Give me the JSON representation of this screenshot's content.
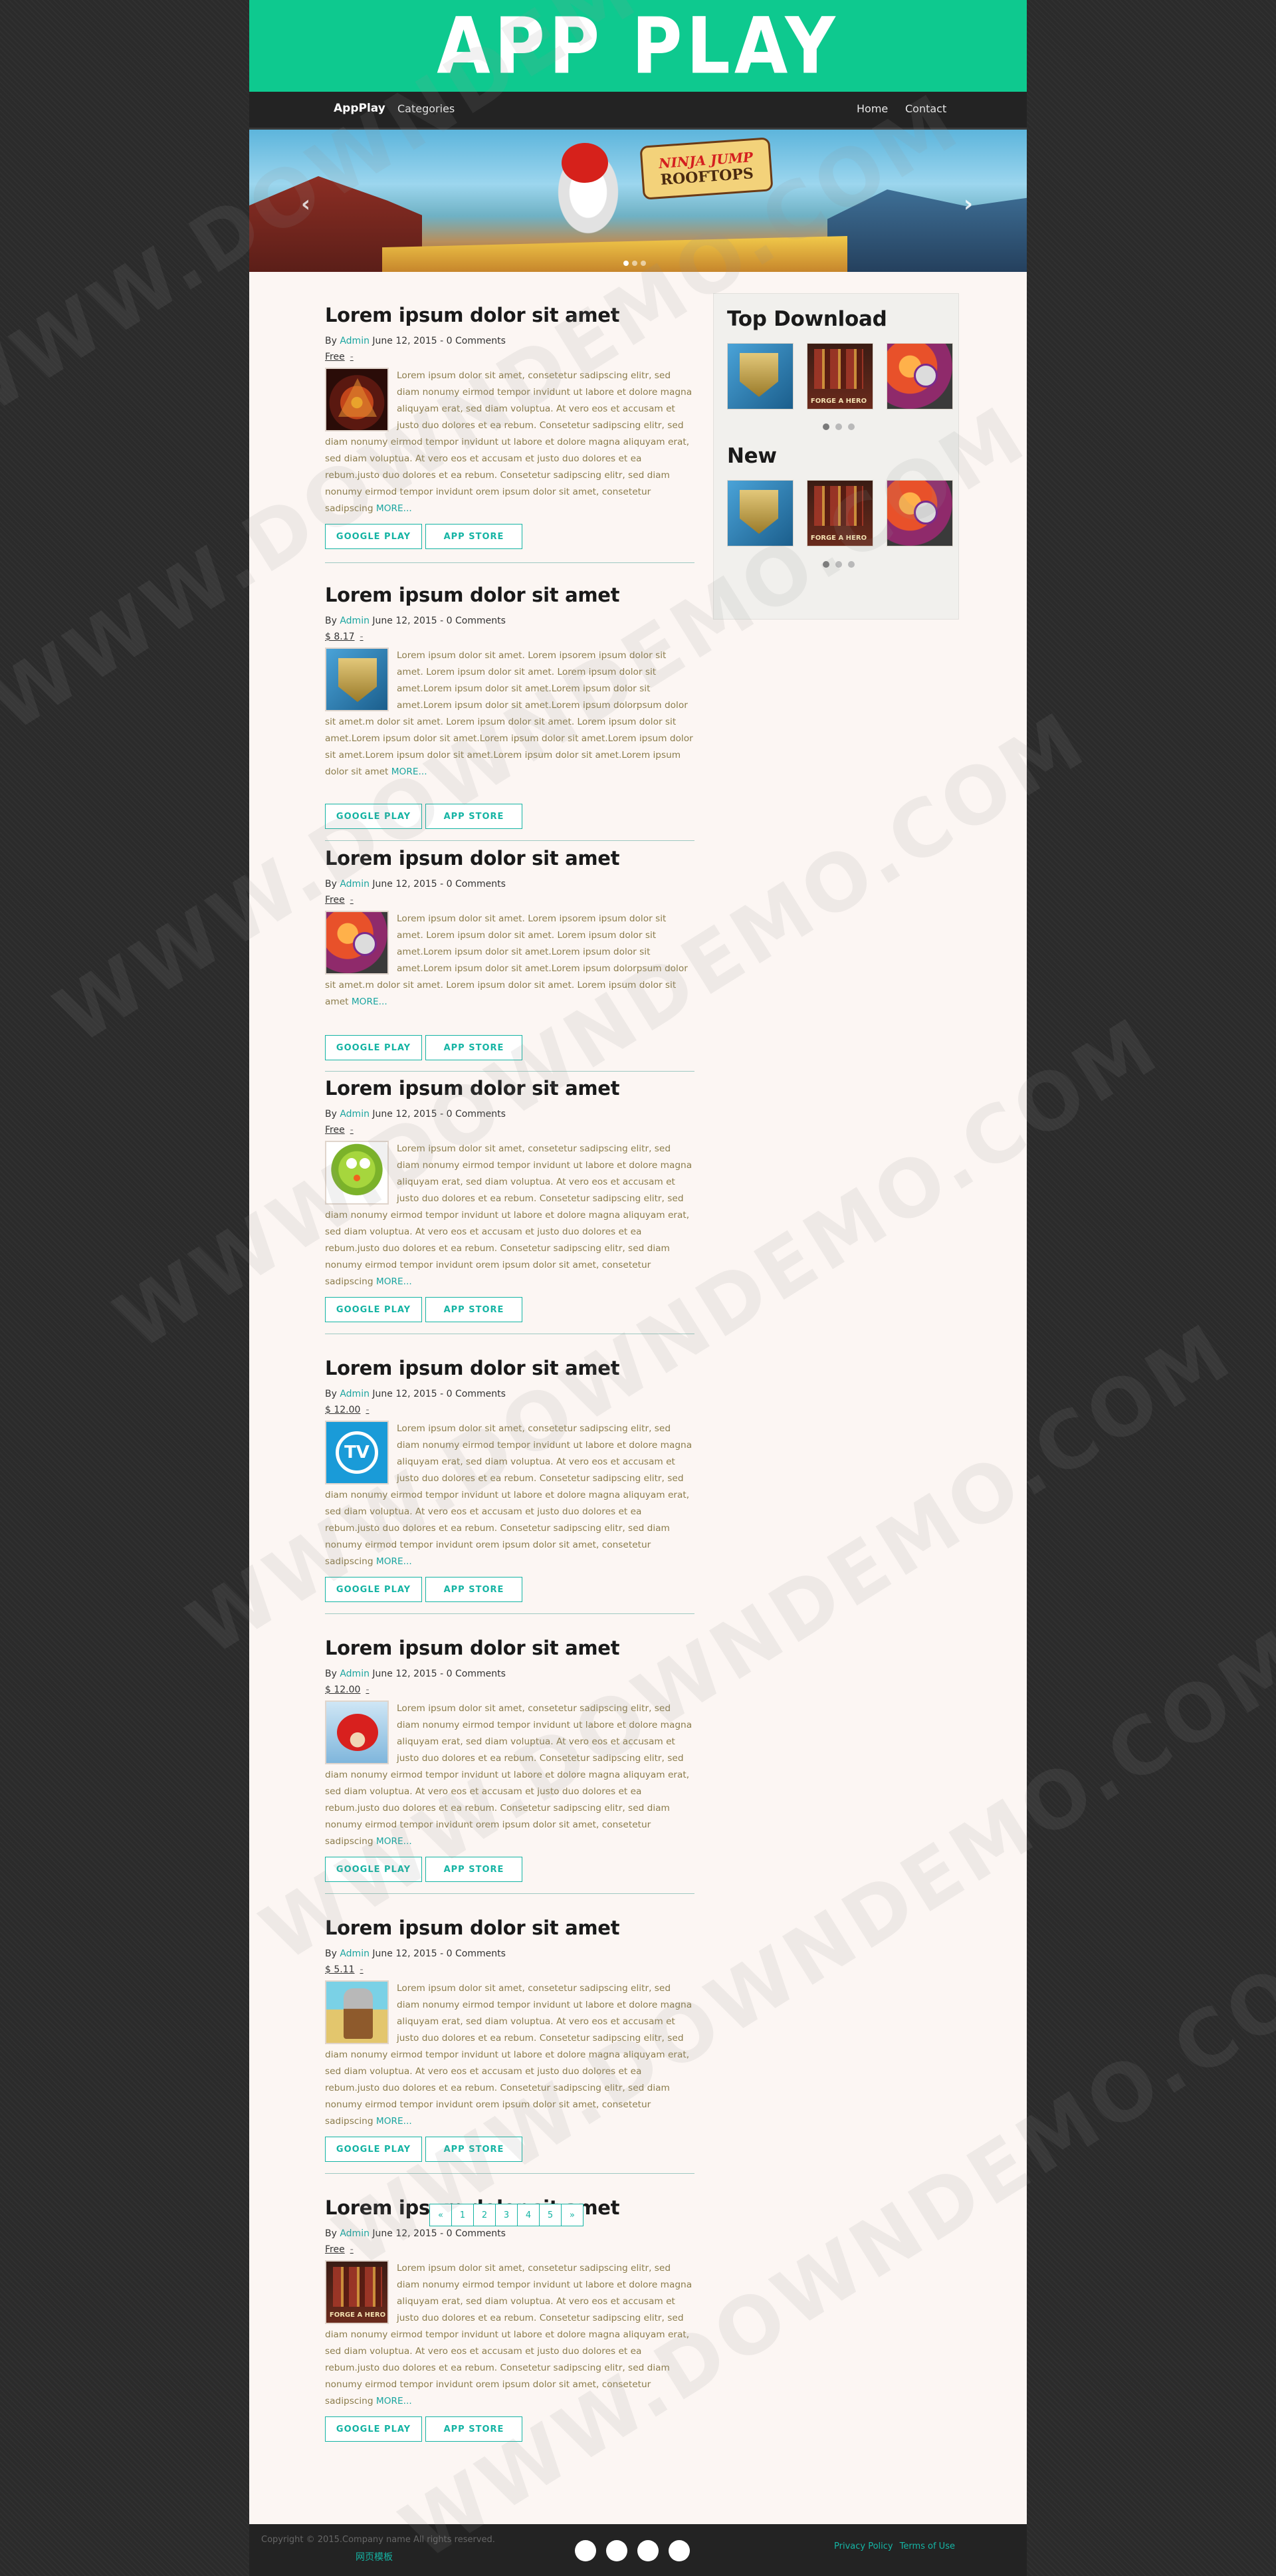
{
  "header": {
    "logo": "APP PLAY"
  },
  "nav": {
    "brand": "AppPlay",
    "categories": "Categories",
    "home": "Home",
    "contact": "Contact"
  },
  "hero": {
    "game_title_1": "NINJA JUMP",
    "game_title_2": "ROOFTOPS",
    "prev_icon": "chevron-left-icon",
    "next_icon": "chevron-right-icon"
  },
  "posts": [
    {
      "title": "Lorem ipsum dolor sit amet",
      "by": "By",
      "author": "Admin",
      "date_comments": "June 12, 2015 - 0 Comments",
      "price": "Free",
      "sep": "-",
      "icon": "eye-icon",
      "body": "Lorem ipsum dolor sit amet, consetetur sadipscing elitr, sed diam nonumy eirmod tempor invidunt ut labore et dolore magna aliquyam erat, sed diam voluptua. At vero eos et accusam et justo duo dolores et ea rebum. Consetetur sadipscing elitr, sed diam nonumy eirmod tempor invidunt ut labore et dolore magna aliquyam erat, sed diam voluptua. At vero eos et accusam et justo duo dolores et ea rebum.justo duo dolores et ea rebum. Consetetur sadipscing elitr, sed diam nonumy eirmod tempor invidunt orem ipsum dolor sit amet, consetetur sadipscing",
      "more": "MORE...",
      "google": "GOOGLE PLAY",
      "apple": "APP STORE"
    },
    {
      "title": "Lorem ipsum dolor sit amet",
      "by": "By",
      "author": "Admin",
      "date_comments": "June 12, 2015 - 0 Comments",
      "price": "$ 8.17",
      "sep": "-",
      "icon": "shield-icon",
      "body": "Lorem ipsum dolor sit amet. Lorem ipsorem ipsum dolor sit amet. Lorem ipsum dolor sit amet. Lorem ipsum dolor sit amet.Lorem ipsum dolor sit amet.Lorem ipsum dolor sit amet.Lorem ipsum dolor sit amet.Lorem ipsum dolorpsum dolor sit amet.m dolor sit amet. Lorem ipsum dolor sit amet. Lorem ipsum dolor sit amet.Lorem ipsum dolor sit amet.Lorem ipsum dolor sit amet.Lorem ipsum dolor sit amet.Lorem ipsum dolor sit amet.Lorem ipsum dolor sit amet.Lorem ipsum dolor sit amet",
      "more": "MORE...",
      "google": "GOOGLE PLAY",
      "apple": "APP STORE"
    },
    {
      "title": "Lorem ipsum dolor sit amet",
      "by": "By",
      "author": "Admin",
      "date_comments": "June 12, 2015 - 0 Comments",
      "price": "Free",
      "sep": "-",
      "icon": "orange-icon",
      "body": "Lorem ipsum dolor sit amet. Lorem ipsorem ipsum dolor sit amet. Lorem ipsum dolor sit amet. Lorem ipsum dolor sit amet.Lorem ipsum dolor sit amet.Lorem ipsum dolor sit amet.Lorem ipsum dolor sit amet.Lorem ipsum dolorpsum dolor sit amet.m dolor sit amet. Lorem ipsum dolor sit amet. Lorem ipsum dolor sit amet",
      "more": "MORE...",
      "google": "GOOGLE PLAY",
      "apple": "APP STORE"
    },
    {
      "title": "Lorem ipsum dolor sit amet",
      "by": "By",
      "author": "Admin",
      "date_comments": "June 12, 2015 - 0 Comments",
      "price": "Free",
      "sep": "-",
      "icon": "bird-icon",
      "body": "Lorem ipsum dolor sit amet, consetetur sadipscing elitr, sed diam nonumy eirmod tempor invidunt ut labore et dolore magna aliquyam erat, sed diam voluptua. At vero eos et accusam et justo duo dolores et ea rebum. Consetetur sadipscing elitr, sed diam nonumy eirmod tempor invidunt ut labore et dolore magna aliquyam erat, sed diam voluptua. At vero eos et accusam et justo duo dolores et ea rebum.justo duo dolores et ea rebum. Consetetur sadipscing elitr, sed diam nonumy eirmod tempor invidunt orem ipsum dolor sit amet, consetetur sadipscing",
      "more": "MORE...",
      "google": "GOOGLE PLAY",
      "apple": "APP STORE"
    },
    {
      "title": "Lorem ipsum dolor sit amet",
      "by": "By",
      "author": "Admin",
      "date_comments": "June 12, 2015 - 0 Comments",
      "price": "$ 12.00",
      "sep": "-",
      "icon": "tv-icon",
      "body": "Lorem ipsum dolor sit amet, consetetur sadipscing elitr, sed diam nonumy eirmod tempor invidunt ut labore et dolore magna aliquyam erat, sed diam voluptua. At vero eos et accusam et justo duo dolores et ea rebum. Consetetur sadipscing elitr, sed diam nonumy eirmod tempor invidunt ut labore et dolore magna aliquyam erat, sed diam voluptua. At vero eos et accusam et justo duo dolores et ea rebum.justo duo dolores et ea rebum. Consetetur sadipscing elitr, sed diam nonumy eirmod tempor invidunt orem ipsum dolor sit amet, consetetur sadipscing",
      "more": "MORE...",
      "google": "GOOGLE PLAY",
      "apple": "APP STORE"
    },
    {
      "title": "Lorem ipsum dolor sit amet",
      "by": "By",
      "author": "Admin",
      "date_comments": "June 12, 2015 - 0 Comments",
      "price": "$ 12.00",
      "sep": "-",
      "icon": "angry-bird-icon",
      "body": "Lorem ipsum dolor sit amet, consetetur sadipscing elitr, sed diam nonumy eirmod tempor invidunt ut labore et dolore magna aliquyam erat, sed diam voluptua. At vero eos et accusam et justo duo dolores et ea rebum. Consetetur sadipscing elitr, sed diam nonumy eirmod tempor invidunt ut labore et dolore magna aliquyam erat, sed diam voluptua. At vero eos et accusam et justo duo dolores et ea rebum.justo duo dolores et ea rebum. Consetetur sadipscing elitr, sed diam nonumy eirmod tempor invidunt orem ipsum dolor sit amet, consetetur sadipscing",
      "more": "MORE...",
      "google": "GOOGLE PLAY",
      "apple": "APP STORE"
    },
    {
      "title": "Lorem ipsum dolor sit amet",
      "by": "By",
      "author": "Admin",
      "date_comments": "June 12, 2015 - 0 Comments",
      "price": "$ 5.11",
      "sep": "-",
      "icon": "knight-icon",
      "body": "Lorem ipsum dolor sit amet, consetetur sadipscing elitr, sed diam nonumy eirmod tempor invidunt ut labore et dolore magna aliquyam erat, sed diam voluptua. At vero eos et accusam et justo duo dolores et ea rebum. Consetetur sadipscing elitr, sed diam nonumy eirmod tempor invidunt ut labore et dolore magna aliquyam erat, sed diam voluptua. At vero eos et accusam et justo duo dolores et ea rebum.justo duo dolores et ea rebum. Consetetur sadipscing elitr, sed diam nonumy eirmod tempor invidunt orem ipsum dolor sit amet, consetetur sadipscing",
      "more": "MORE...",
      "google": "GOOGLE PLAY",
      "apple": "APP STORE"
    },
    {
      "title": "Lorem ipsum dolor sit amet",
      "by": "By",
      "author": "Admin",
      "date_comments": "June 12, 2015 - 0 Comments",
      "price": "Free",
      "sep": "-",
      "icon": "forge-hero-icon",
      "body": "Lorem ipsum dolor sit amet, consetetur sadipscing elitr, sed diam nonumy eirmod tempor invidunt ut labore et dolore magna aliquyam erat, sed diam voluptua. At vero eos et accusam et justo duo dolores et ea rebum. Consetetur sadipscing elitr, sed diam nonumy eirmod tempor invidunt ut labore et dolore magna aliquyam erat, sed diam voluptua. At vero eos et accusam et justo duo dolores et ea rebum.justo duo dolores et ea rebum. Consetetur sadipscing elitr, sed diam nonumy eirmod tempor invidunt orem ipsum dolor sit amet, consetetur sadipscing",
      "more": "MORE...",
      "google": "GOOGLE PLAY",
      "apple": "APP STORE"
    }
  ],
  "sidebar": {
    "top_title": "Top Download",
    "new_title": "New",
    "forge_caption": "FORGE A HERO",
    "thumbs": [
      "shield-icon",
      "forge-hero-icon",
      "orange-icon"
    ]
  },
  "pagination": [
    "«",
    "1",
    "2",
    "3",
    "4",
    "5",
    "»"
  ],
  "footer": {
    "copyright": "Copyright © 2015.Company name All rights reserved.",
    "cn_link": "网页模板",
    "privacy": "Privacy Policy",
    "terms": "Terms of Use",
    "social_icons": [
      "social-icon-1",
      "social-icon-2",
      "social-icon-3",
      "social-icon-4"
    ]
  },
  "watermark": "WWW.DOWNDEMO.COM"
}
